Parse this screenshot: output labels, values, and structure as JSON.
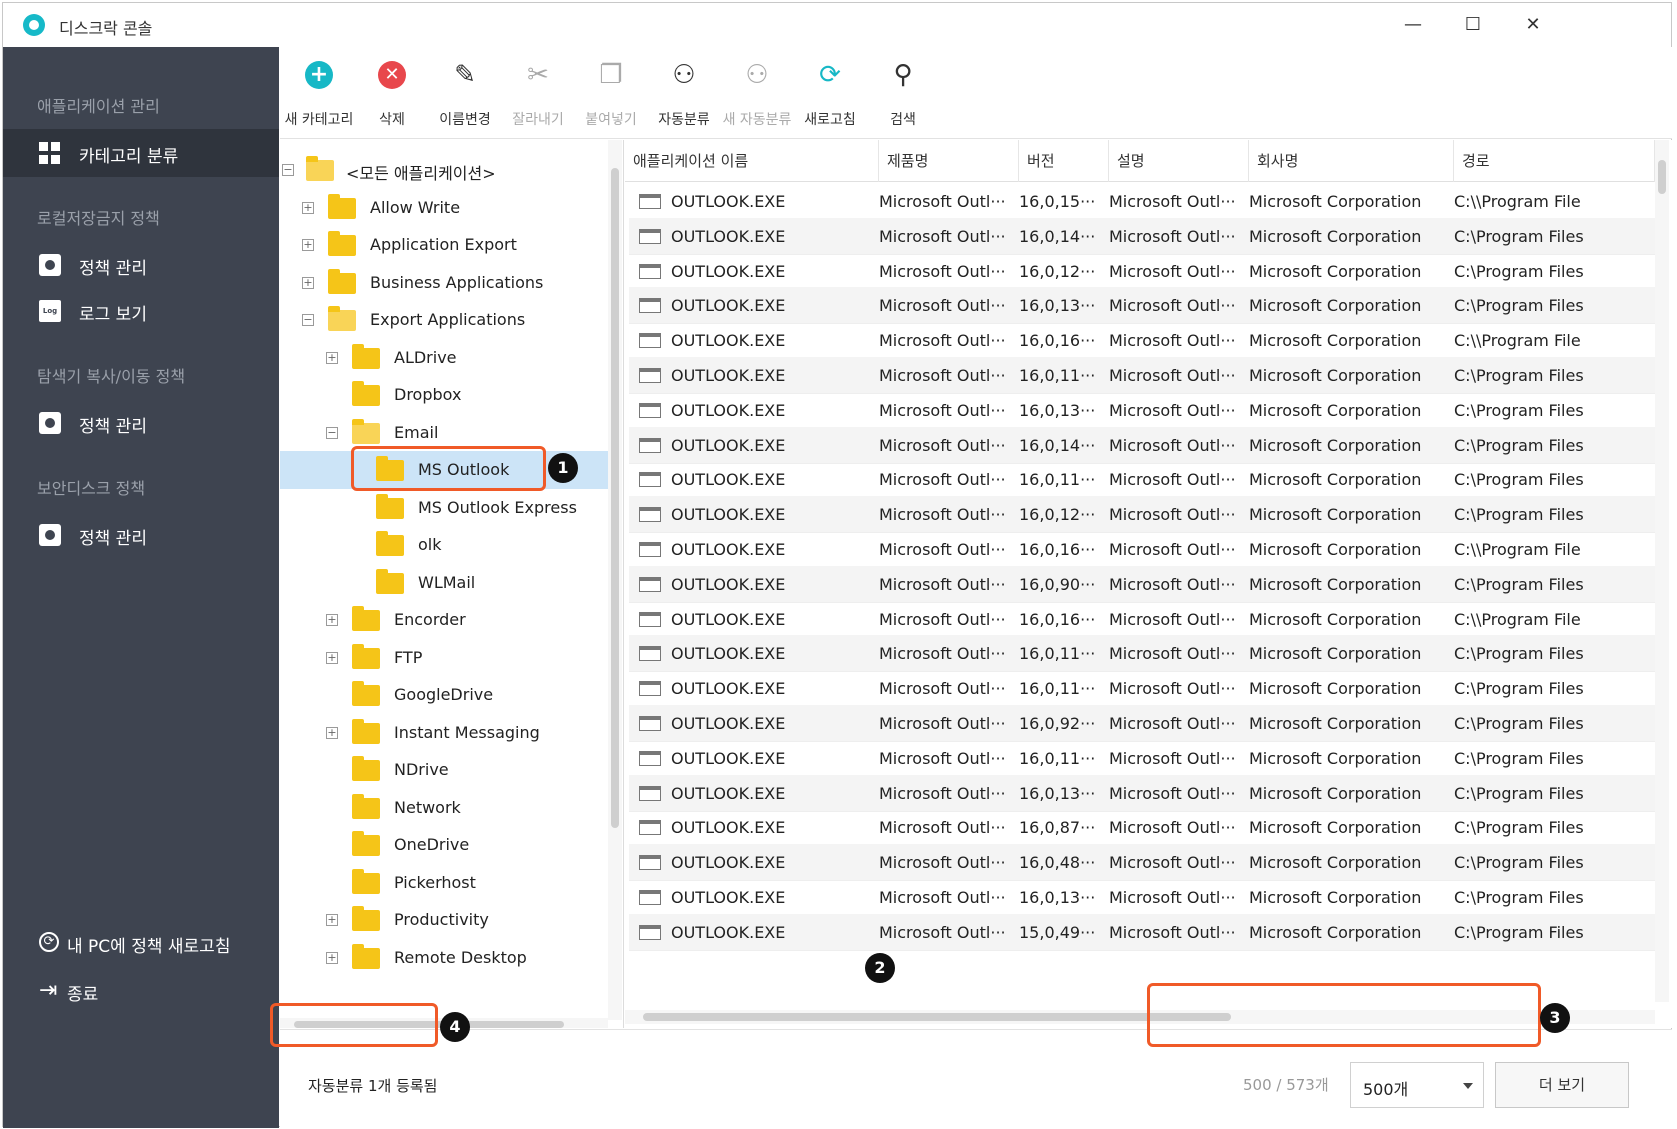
{
  "app": {
    "title": "디스크락 콘솔",
    "window_controls": {
      "minimize": "—",
      "maximize": "☐",
      "close": "✕"
    }
  },
  "sidebar": {
    "sections": [
      {
        "label": "애플리케이션 관리",
        "items": [
          {
            "label": "카테고리 분류",
            "icon": "grid-icon",
            "active": true
          }
        ]
      },
      {
        "label": "로컬저장금지 정책",
        "items": [
          {
            "label": "정책 관리",
            "icon": "gear-icon"
          },
          {
            "label": "로그 보기",
            "icon": "log-icon"
          }
        ]
      },
      {
        "label": "탐색기 복사/이동 정책",
        "items": [
          {
            "label": "정책 관리",
            "icon": "gear-icon"
          }
        ]
      },
      {
        "label": "보안디스크 정책",
        "items": [
          {
            "label": "정책 관리",
            "icon": "gear-icon"
          }
        ]
      }
    ],
    "bottom": [
      {
        "label": "내 PC에 정책 새로고침",
        "icon": "refresh-icon"
      },
      {
        "label": "종료",
        "icon": "exit-icon"
      }
    ]
  },
  "toolbar": [
    {
      "label": "새 카테고리",
      "icon": "plus-circle-icon",
      "enabled": true
    },
    {
      "label": "삭제",
      "icon": "x-circle-icon",
      "enabled": true
    },
    {
      "label": "이름변경",
      "icon": "edit-icon",
      "enabled": true
    },
    {
      "label": "잘라내기",
      "icon": "scissors-icon",
      "enabled": false
    },
    {
      "label": "붙여넣기",
      "icon": "paste-icon",
      "enabled": false
    },
    {
      "label": "자동분류",
      "icon": "hierarchy-icon",
      "enabled": true
    },
    {
      "label": "새 자동분류",
      "icon": "hierarchy-add-icon",
      "enabled": false
    },
    {
      "label": "새로고침",
      "icon": "refresh-icon",
      "enabled": true
    },
    {
      "label": "검색",
      "icon": "search-icon",
      "enabled": true
    }
  ],
  "tree": [
    {
      "label": "<모든 애플리케이션>",
      "level": 0,
      "expander": "−",
      "open": true
    },
    {
      "label": "Allow Write",
      "level": 1,
      "expander": "+"
    },
    {
      "label": "Application Export",
      "level": 1,
      "expander": "+"
    },
    {
      "label": "Business Applications",
      "level": 1,
      "expander": "+"
    },
    {
      "label": "Export Applications",
      "level": 1,
      "expander": "−",
      "open": true
    },
    {
      "label": "ALDrive",
      "level": 2,
      "expander": "+"
    },
    {
      "label": "Dropbox",
      "level": 2,
      "expander": ""
    },
    {
      "label": "Email",
      "level": 2,
      "expander": "−",
      "open": true
    },
    {
      "label": "MS Outlook",
      "level": 3,
      "expander": "",
      "selected": true
    },
    {
      "label": "MS Outlook Express",
      "level": 3,
      "expander": ""
    },
    {
      "label": "olk",
      "level": 3,
      "expander": ""
    },
    {
      "label": "WLMail",
      "level": 3,
      "expander": ""
    },
    {
      "label": "Encorder",
      "level": 2,
      "expander": "+"
    },
    {
      "label": "FTP",
      "level": 2,
      "expander": "+"
    },
    {
      "label": "GoogleDrive",
      "level": 2,
      "expander": ""
    },
    {
      "label": "Instant Messaging",
      "level": 2,
      "expander": "+"
    },
    {
      "label": "NDrive",
      "level": 2,
      "expander": ""
    },
    {
      "label": "Network",
      "level": 2,
      "expander": ""
    },
    {
      "label": "OneDrive",
      "level": 2,
      "expander": ""
    },
    {
      "label": "Pickerhost",
      "level": 2,
      "expander": ""
    },
    {
      "label": "Productivity",
      "level": 2,
      "expander": "+"
    },
    {
      "label": "Remote Desktop",
      "level": 2,
      "expander": "+"
    }
  ],
  "grid": {
    "columns": [
      "애플리케이션 이름",
      "제품명",
      "버전",
      "설명",
      "회사명",
      "경로"
    ],
    "rows": [
      [
        "OUTLOOK.EXE",
        "Microsoft Outl···",
        "16,0,15···",
        "Microsoft Outl···",
        "Microsoft Corporation",
        "C:\\\\Program File"
      ],
      [
        "OUTLOOK.EXE",
        "Microsoft Outl···",
        "16,0,14···",
        "Microsoft Outl···",
        "Microsoft Corporation",
        "C:\\Program Files"
      ],
      [
        "OUTLOOK.EXE",
        "Microsoft Outl···",
        "16,0,12···",
        "Microsoft Outl···",
        "Microsoft Corporation",
        "C:\\Program Files"
      ],
      [
        "OUTLOOK.EXE",
        "Microsoft Outl···",
        "16,0,13···",
        "Microsoft Outl···",
        "Microsoft Corporation",
        "C:\\Program Files"
      ],
      [
        "OUTLOOK.EXE",
        "Microsoft Outl···",
        "16,0,16···",
        "Microsoft Outl···",
        "Microsoft Corporation",
        "C:\\\\Program File"
      ],
      [
        "OUTLOOK.EXE",
        "Microsoft Outl···",
        "16,0,11···",
        "Microsoft Outl···",
        "Microsoft Corporation",
        "C:\\Program Files"
      ],
      [
        "OUTLOOK.EXE",
        "Microsoft Outl···",
        "16,0,13···",
        "Microsoft Outl···",
        "Microsoft Corporation",
        "C:\\Program Files"
      ],
      [
        "OUTLOOK.EXE",
        "Microsoft Outl···",
        "16,0,14···",
        "Microsoft Outl···",
        "Microsoft Corporation",
        "C:\\Program Files"
      ],
      [
        "OUTLOOK.EXE",
        "Microsoft Outl···",
        "16,0,11···",
        "Microsoft Outl···",
        "Microsoft Corporation",
        "C:\\Program Files"
      ],
      [
        "OUTLOOK.EXE",
        "Microsoft Outl···",
        "16,0,12···",
        "Microsoft Outl···",
        "Microsoft Corporation",
        "C:\\Program Files"
      ],
      [
        "OUTLOOK.EXE",
        "Microsoft Outl···",
        "16,0,16···",
        "Microsoft Outl···",
        "Microsoft Corporation",
        "C:\\\\Program File"
      ],
      [
        "OUTLOOK.EXE",
        "Microsoft Outl···",
        "16,0,90···",
        "Microsoft Outl···",
        "Microsoft Corporation",
        "C:\\Program Files"
      ],
      [
        "OUTLOOK.EXE",
        "Microsoft Outl···",
        "16,0,16···",
        "Microsoft Outl···",
        "Microsoft Corporation",
        "C:\\\\Program File"
      ],
      [
        "OUTLOOK.EXE",
        "Microsoft Outl···",
        "16,0,11···",
        "Microsoft Outl···",
        "Microsoft Corporation",
        "C:\\Program Files"
      ],
      [
        "OUTLOOK.EXE",
        "Microsoft Outl···",
        "16,0,11···",
        "Microsoft Outl···",
        "Microsoft Corporation",
        "C:\\Program Files"
      ],
      [
        "OUTLOOK.EXE",
        "Microsoft Outl···",
        "16,0,92···",
        "Microsoft Outl···",
        "Microsoft Corporation",
        "C:\\Program Files"
      ],
      [
        "OUTLOOK.EXE",
        "Microsoft Outl···",
        "16,0,11···",
        "Microsoft Outl···",
        "Microsoft Corporation",
        "C:\\Program Files"
      ],
      [
        "OUTLOOK.EXE",
        "Microsoft Outl···",
        "16,0,13···",
        "Microsoft Outl···",
        "Microsoft Corporation",
        "C:\\Program Files"
      ],
      [
        "OUTLOOK.EXE",
        "Microsoft Outl···",
        "16,0,87···",
        "Microsoft Outl···",
        "Microsoft Corporation",
        "C:\\Program Files"
      ],
      [
        "OUTLOOK.EXE",
        "Microsoft Outl···",
        "16,0,48···",
        "Microsoft Outl···",
        "Microsoft Corporation",
        "C:\\Program Files"
      ],
      [
        "OUTLOOK.EXE",
        "Microsoft Outl···",
        "16,0,13···",
        "Microsoft Outl···",
        "Microsoft Corporation",
        "C:\\Program Files"
      ],
      [
        "OUTLOOK.EXE",
        "Microsoft Outl···",
        "15,0,49···",
        "Microsoft Outl···",
        "Microsoft Corporation",
        "C:\\Program Files"
      ]
    ]
  },
  "footer": {
    "status": "자동분류 1개 등록됨",
    "count": "500 / 573개",
    "page_size": "500개",
    "more_button": "더 보기"
  },
  "callouts": [
    "1",
    "2",
    "3",
    "4"
  ],
  "colors": {
    "sidebar_bg": "#3e4450",
    "accent": "#17b8c6",
    "delete": "#e8474c",
    "selection": "#cce4f7",
    "callout": "#f05a28",
    "folder": "#f5c518"
  }
}
